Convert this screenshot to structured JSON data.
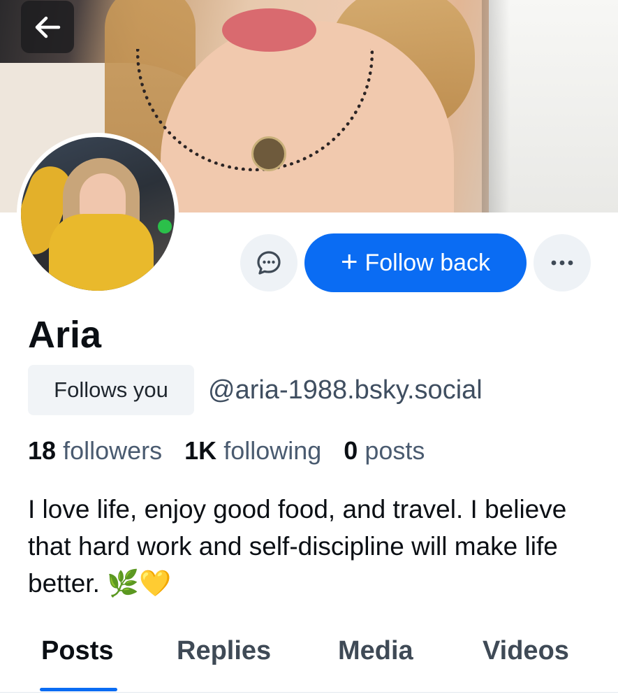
{
  "header": {
    "back_icon": "arrow-left-icon"
  },
  "profile": {
    "display_name": "Aria",
    "follows_you_label": "Follows you",
    "handle": "@aria-1988.bsky.social",
    "bio": "I love life, enjoy good food, and travel. I believe that hard work and self-discipline will make life better. 🌿💛"
  },
  "actions": {
    "message_icon": "message-bubble-icon",
    "follow_plus": "+",
    "follow_label": "Follow back",
    "more_icon": "more-horizontal-icon"
  },
  "stats": {
    "followers_count": "18",
    "followers_label": "followers",
    "following_count": "1K",
    "following_label": "following",
    "posts_count": "0",
    "posts_label": "posts"
  },
  "tabs": [
    {
      "label": "Posts",
      "active": true
    },
    {
      "label": "Replies",
      "active": false
    },
    {
      "label": "Media",
      "active": false
    },
    {
      "label": "Videos",
      "active": false
    }
  ],
  "colors": {
    "accent": "#0a6cf3",
    "muted_text": "#4a5b70",
    "button_bg": "#eef2f6"
  }
}
